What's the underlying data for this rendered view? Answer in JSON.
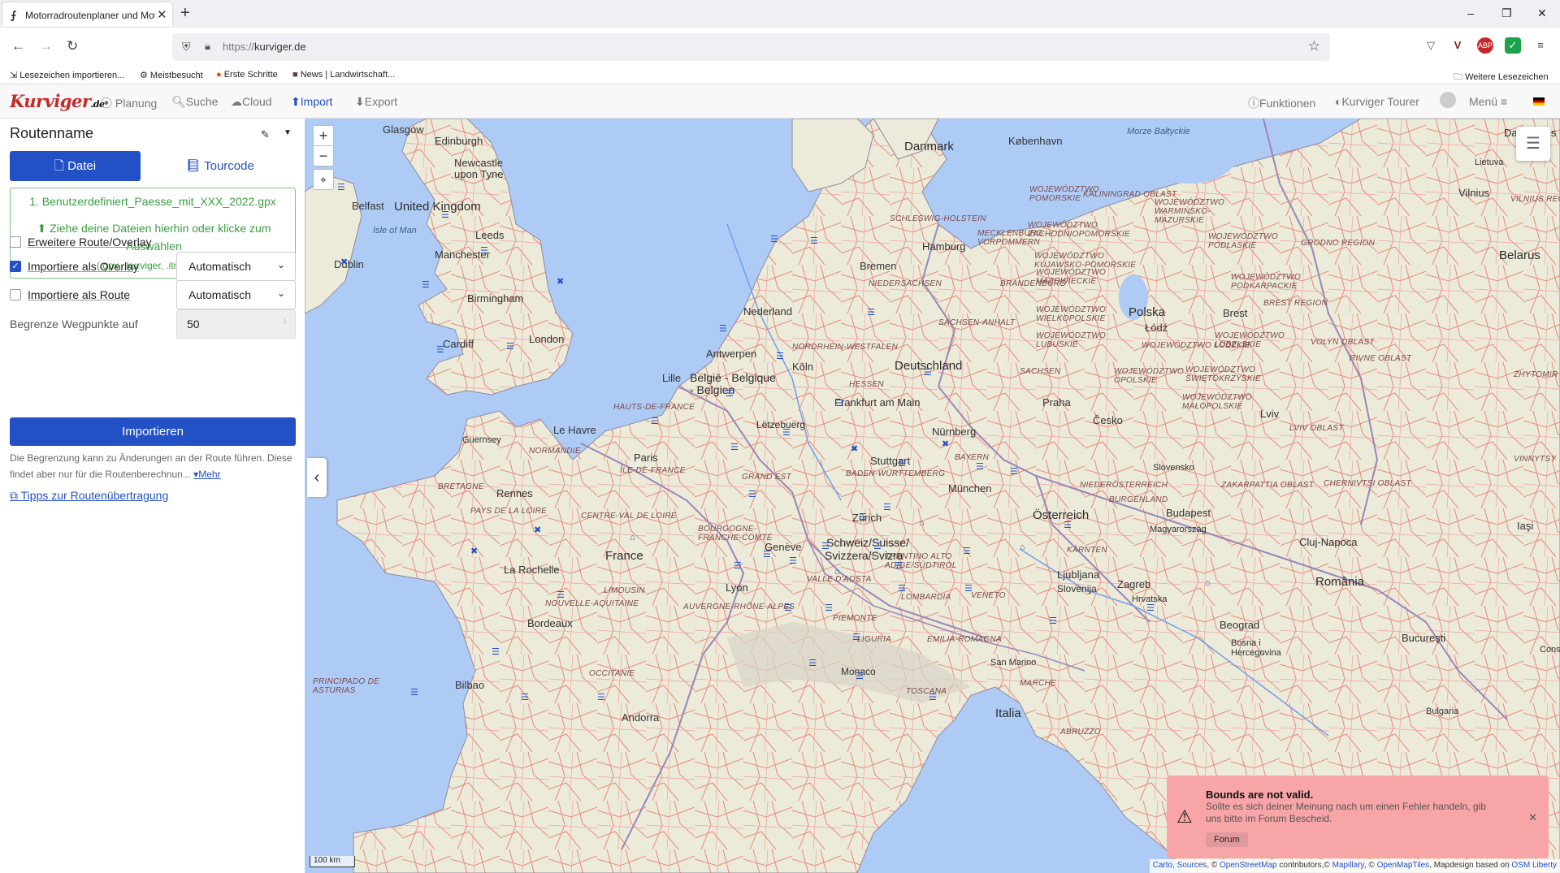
{
  "browser": {
    "tab_title": "Motorradroutenplaner und Mot",
    "url_proto": "https://",
    "url_host": "kurviger.de",
    "bookmarks": [
      "Lesezeichen importieren...",
      "Meistbesucht",
      "Erste Schritte",
      "News | Landwirtschaft..."
    ],
    "bookmarks_right": "Weitere Lesezeichen",
    "window_controls": [
      "–",
      "❐",
      "✕"
    ]
  },
  "appnav": {
    "logo_main": "Kurv",
    "logo_accent": "iger",
    "logo_suffix": ".de",
    "items": [
      {
        "icon": "compass-icon",
        "label": "Planung"
      },
      {
        "icon": "search-icon",
        "label": "Suche"
      },
      {
        "icon": "cloud-icon",
        "label": "Cloud"
      },
      {
        "icon": "upload-icon",
        "label": "Import",
        "active": true
      },
      {
        "icon": "download-icon",
        "label": "Export"
      }
    ],
    "right": {
      "funktionen": "Funktionen",
      "tourer": "Kurviger Tourer",
      "menu": "Menü"
    }
  },
  "sidebar": {
    "route_name": "Routenname",
    "tab_datei": "Datei",
    "tab_tourcode": "Tourcode",
    "file_item": "1. Benutzerdefiniert_Paesse_mit_XXX_2022.gpx",
    "dropzone_text": "Ziehe deine Dateien hierhin oder klicke zum Auswählen",
    "dropzone_ext": "(.gpx, .kurviger, .itn, .mps)",
    "opt_extended": {
      "label": "Erweitere Route/Overlay",
      "checked": false
    },
    "opt_overlay": {
      "label": "Importiere als Overlay",
      "checked": true,
      "select": "Automatisch"
    },
    "opt_route": {
      "label": "Importiere als Route",
      "checked": false,
      "select": "Automatisch"
    },
    "limit_label": "Begrenze Wegpunkte auf",
    "limit_value": "50",
    "import_button": "Importieren",
    "note": "Die Begrenzung kann zu Änderungen an der Route führen. Diese findet aber nur für die Routenberechnun...",
    "note_more": "Mehr",
    "tips_link": "Tipps zur Routenübertragung"
  },
  "map": {
    "zoom_in": "+",
    "zoom_out": "−",
    "scale": "100 km",
    "attribution": {
      "carto": "Carto",
      "sources": "Sources",
      "osm": "OpenStreetMap",
      "mid1": " contributors,© ",
      "mapillary": "Mapillary",
      "mid2": ", © ",
      "openmaptiles": "OpenMapTiles",
      "mid3": ", Mapdesign based on ",
      "osmliberty": "OSM Liberty"
    },
    "labels": {
      "Glasgow": "Glasgow",
      "Edinburgh": "Edinburgh",
      "Newcastle": "Newcastle upon Tyne",
      "UK": "United Kingdom",
      "Belfast": "Belfast",
      "IsleOfMan": "Isle of Man",
      "Dublin": "Dublin",
      "Leeds": "Leeds",
      "Manchester": "Manchester",
      "Birmingham": "Birmingham",
      "Cardiff": "Cardiff",
      "London": "London",
      "Guernsey": "Guernsey",
      "LeHavre": "Le Havre",
      "Rennes": "Rennes",
      "Paris": "Paris",
      "France": "France",
      "LaRochelle": "La Rochelle",
      "Bordeaux": "Bordeaux",
      "Lyon": "Lyon",
      "Geneve": "Genève",
      "Bilbao": "Bilbao",
      "Andorra": "Andorra",
      "Monaco": "Monaco",
      "Nederland": "Nederland",
      "Antwerpen": "Antwerpen",
      "Belgie": "België - Belgique - Belgien",
      "Lille": "Lille",
      "Letzebuerg": "Lëtzebuerg",
      "Koln": "Köln",
      "Bremen": "Bremen",
      "Hamburg": "Hamburg",
      "Danmark": "Danmark",
      "Kobenhavn": "København",
      "Deutschland": "Deutschland",
      "Frankfurt": "Frankfurt am Main",
      "Nurnberg": "Nürnberg",
      "Stuttgart": "Stuttgart",
      "Munchen": "München",
      "Zurich": "Zürich",
      "Schweiz": "Schweiz/Suisse/",
      "Svizzera": "Svizzera/Svizra",
      "Osterreich": "Österreich",
      "Praha": "Praha",
      "Cesko": "Česko",
      "Polska": "Polska",
      "Lodz": "Łódź",
      "Brest": "Brest",
      "Lviv": "Lviv",
      "Budapest": "Budapest",
      "Magyarorszag": "Magyarország",
      "Slovensko": "Slovensko",
      "Ljubljana": "Ljubljana",
      "Slovenija": "Slovenija",
      "Zagreb": "Zagreb",
      "Hrvatska": "Hrvatska",
      "Beograd": "Beograd",
      "Romania": "România",
      "ClujNapoca": "Cluj-Napoca",
      "Bucuresti": "Bucureşti",
      "Italia": "Italia",
      "SanMarino": "San Marino",
      "Belarus": "Belarus",
      "Lietuva": "Lietuva",
      "Vilnius": "Vilnius",
      "Daugavpils": "Daugavpils",
      "Iasi": "Iaşi",
      "Bosna": "Bosna i Hercegovina",
      "MorzeBaltyckie": "Morze Bałtyckie",
      "Vinnytsia": "VINNYTSY",
      "Zhytomir": "ZHYTOMIR",
      "Bulgaria": "Bulgaria",
      "Cons": "Cons"
    },
    "regions": [
      "SCHLESWIG-HOLSTEIN",
      "MECKLENBURG VORPOMMERN",
      "NIEDERSACHSEN",
      "BRANDENBURG",
      "SACHSEN-ANHALT",
      "NORDRHEIN-WESTFALEN",
      "HESSEN",
      "SACHSEN",
      "BAYERN",
      "BADEN-WÜRTTEMBERG",
      "HAUTS-DE-FRANCE",
      "NORMANDIE",
      "ÎLE-DE-FRANCE",
      "GRAND EST",
      "BRETAGNE",
      "PAYS DE LA LOIRE",
      "CENTRE-VAL DE LOIRE",
      "BOURGOGNE- FRANCHE-COMTÉ",
      "AUVERGNE-RHÔNE-ALPES",
      "NOUVELLE-AQUITAINE",
      "OCCITANIE",
      "LIMOUSIN",
      "PRINCIPADO DE ASTURIAS",
      "PIEMONTE",
      "LOMBARDIA",
      "VENETO",
      "LIGURIA",
      "EMILIA-ROMAGNA",
      "TOSCANA",
      "MARCHE",
      "ABRUZZO",
      "VALLE D'AOSTA",
      "TRENTINO ALTO ADIGE/SÜDTIROL",
      "KÄRNTEN",
      "NIEDERÖSTERREICH",
      "BURGENLAND",
      "WOJEWÓDZTWO POMORSKIE",
      "WOJEWÓDZTWO ZACHODNIOPOMORSKIE",
      "WOJEWÓDZTWO KUJAWSKO-POMORSKIE",
      "WOJEWÓDZTWO WARMIŃSKO-MAZURSKIE",
      "WOJEWÓDZTWO PODLASKIE",
      "WOJEWÓDZTWO MAZOWIECKIE",
      "WOJEWÓDZTWO WIELKOPOLSKIE",
      "WOJEWÓDZTWO LUBUSKIE",
      "WOJEWÓDZTWO ŁÓDZKIE",
      "WOJEWÓDZTWO LUBELSKIE",
      "WOJEWÓDZTWO OPOLSKIE",
      "WOJEWÓDZTWO ŚWIĘTOKRZYSKIE",
      "WOJEWÓDZTWO MAŁOPOLSKIE",
      "WOJEWÓDZTWO PODKARPACKIE",
      "KALININGRAD OBLAST",
      "GRODNO REGION",
      "BREST REGION",
      "VOLYN OBLAST",
      "RIVNE OBLAST",
      "LVIV OBLAST",
      "ZAKARPATTIA OBLAST",
      "CHERNIVTSI OBLAST",
      "VILNIUS REGION"
    ]
  },
  "toast": {
    "title": "Bounds are not valid.",
    "message": "Sollte es sich deiner Meinung nach um einen Fehler handeln, gib uns bitte im Forum Bescheid.",
    "button": "Forum"
  },
  "colors": {
    "accent": "#2250c5",
    "land": "#ecead9",
    "water": "#aecbf6",
    "roads": "#e05a4e",
    "toast": "#f8a5a8"
  }
}
